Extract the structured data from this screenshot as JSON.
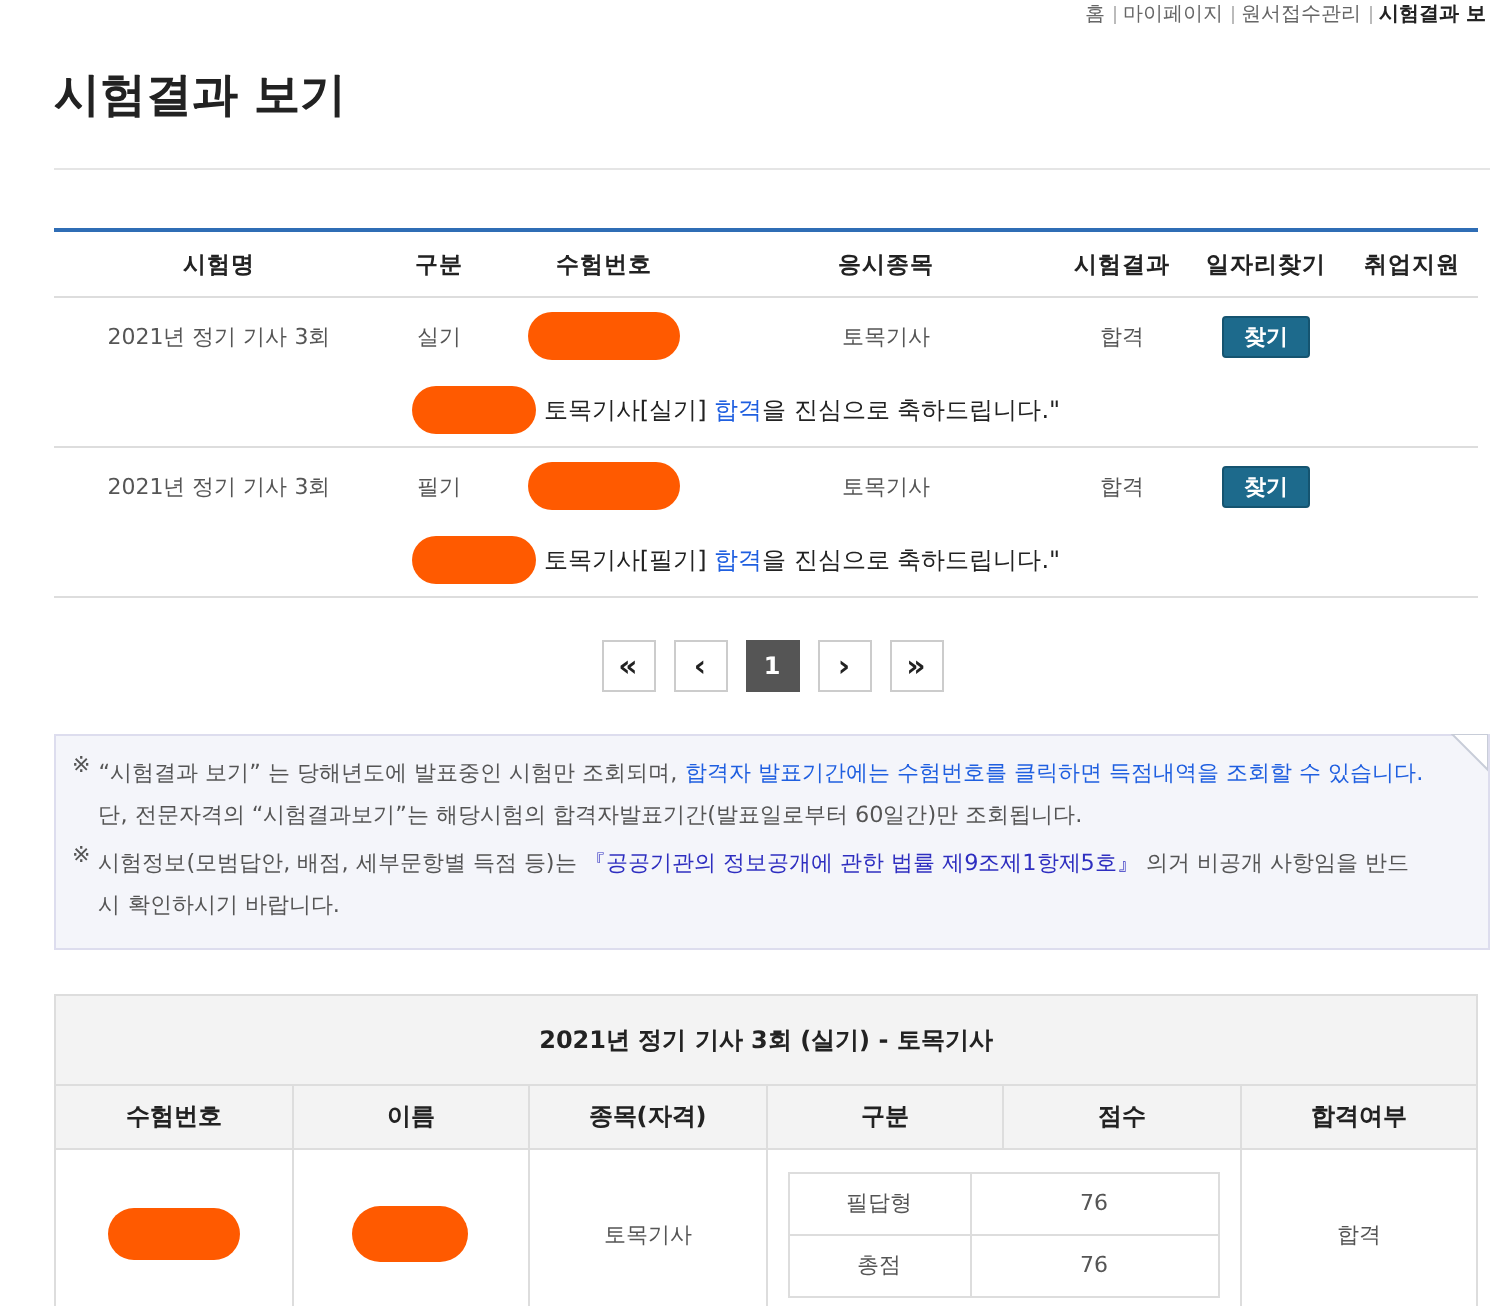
{
  "breadcrumb": [
    {
      "label": "홈",
      "current": false
    },
    {
      "label": "마이페이지",
      "current": false
    },
    {
      "label": "원서접수관리",
      "current": false
    },
    {
      "label": "시험결과 보",
      "current": true
    }
  ],
  "page_title": "시험결과 보기",
  "results_table": {
    "columns": [
      "시험명",
      "구분",
      "수험번호",
      "응시종목",
      "시험결과",
      "일자리찾기",
      "취업지원"
    ],
    "rows": [
      {
        "exam": "2021년 정기 기사 3회",
        "type": "실기",
        "number_redacted": true,
        "subject": "토목기사",
        "result": "합격",
        "button": "찾기",
        "message": [
          {
            "text": "토목기사[실기] ",
            "kind": "plain"
          },
          {
            "text": "합격",
            "kind": "blue"
          },
          {
            "text": "을 진심으로 축하드립니다.\"",
            "kind": "plain"
          }
        ]
      },
      {
        "exam": "2021년 정기 기사 3회",
        "type": "필기",
        "number_redacted": true,
        "subject": "토목기사",
        "result": "합격",
        "button": "찾기",
        "message": [
          {
            "text": "토목기사[필기] ",
            "kind": "plain"
          },
          {
            "text": "합격",
            "kind": "blue"
          },
          {
            "text": "을 진심으로 축하드립니다.\"",
            "kind": "plain"
          }
        ]
      }
    ]
  },
  "pagination": [
    {
      "label": "«",
      "selected": false
    },
    {
      "label": "‹",
      "selected": false
    },
    {
      "label": "1",
      "selected": true
    },
    {
      "label": "›",
      "selected": false
    },
    {
      "label": "»",
      "selected": false
    }
  ],
  "notices": [
    {
      "mark": "※",
      "parts": [
        {
          "text": "“시험결과 보기” 는 당해년도에 발표중인 시험만 조회되며, ",
          "kind": "plain"
        },
        {
          "text": "합격자 발표기간에는 수험번호를 클릭하면 득점내역을 조회할 수 있습니다.",
          "kind": "blue"
        },
        {
          "text": " 단, 전문자격의 “시험결과보기”는 해당시험의 합격자발표기간(발표일로부터 60일간)만 조회됩니다.",
          "kind": "plain"
        }
      ]
    },
    {
      "mark": "※",
      "parts": [
        {
          "text": "시험정보(모범답안, 배점, 세부문항별 득점 등)는 ",
          "kind": "plain"
        },
        {
          "text": "『공공기관의 정보공개에 관한 법률 제9조제1항제5호』",
          "kind": "navy"
        },
        {
          "text": " 의거 비공개 사항임을 반드시 확인하시기 바랍니다.",
          "kind": "plain"
        }
      ]
    }
  ],
  "score_table": {
    "caption": "2021년 정기 기사 3회 (실기) - 토목기사",
    "columns": [
      "수험번호",
      "이름",
      "종목(자격)",
      "구분",
      "점수",
      "합격여부"
    ],
    "number_redacted": true,
    "name_redacted": true,
    "subject": "토목기사",
    "scores": [
      {
        "type": "필답형",
        "score": "76"
      },
      {
        "type": "총점",
        "score": "76"
      }
    ],
    "result": "합격"
  }
}
